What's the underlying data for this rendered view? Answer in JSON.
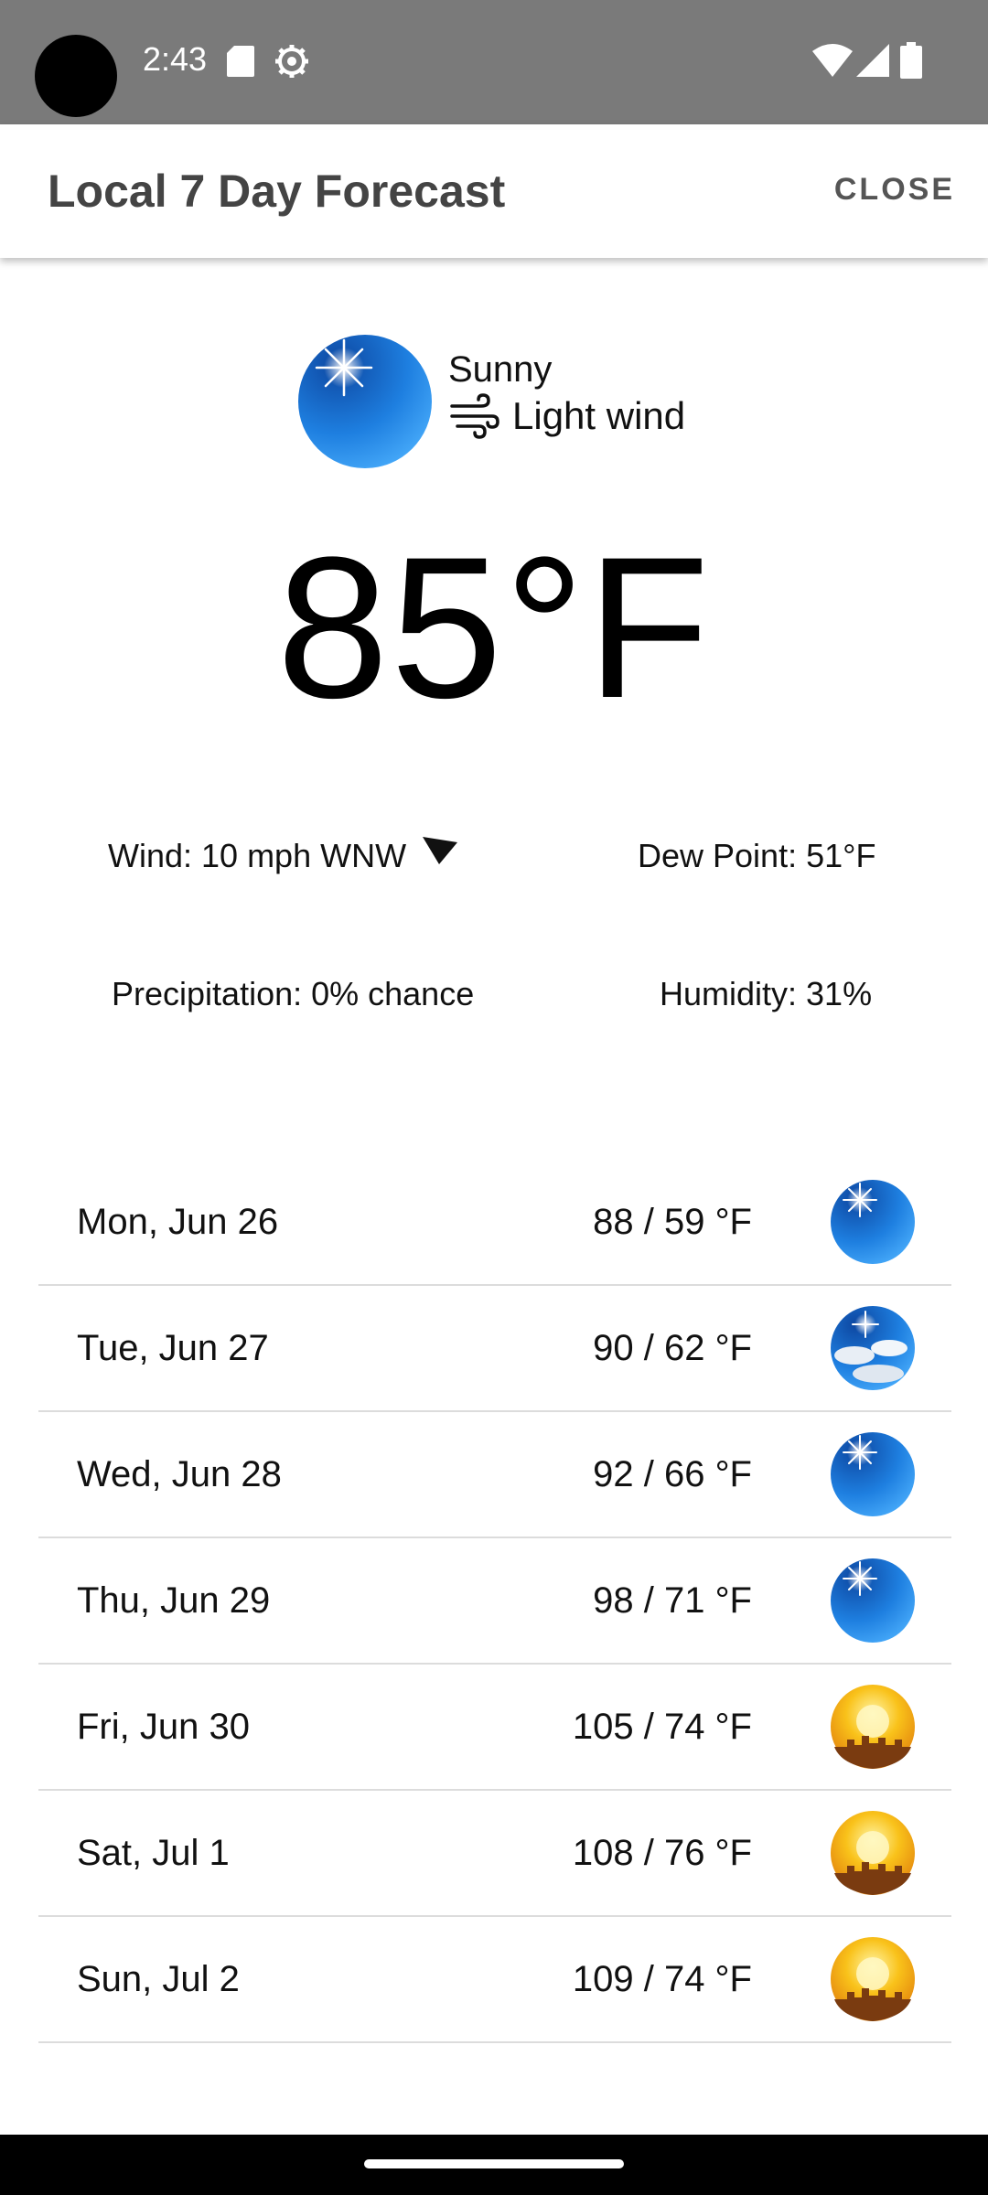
{
  "status_bar": {
    "time": "2:43",
    "icons": [
      "sd-card-icon",
      "gear-icon",
      "wifi-icon",
      "signal-icon",
      "battery-icon"
    ]
  },
  "app_bar": {
    "title": "Local 7 Day Forecast",
    "close_label": "CLOSE"
  },
  "current": {
    "condition": "Sunny",
    "wind_description": "Light wind",
    "temperature": "85°F",
    "icon": "sunny-icon"
  },
  "details": {
    "wind": "Wind: 10 mph WNW",
    "dew_point": "Dew Point: 51°F",
    "precipitation": "Precipitation: 0% chance",
    "humidity": "Humidity: 31%"
  },
  "forecast": [
    {
      "day": "Mon, Jun 26",
      "temps": "88 / 59 °F",
      "icon": "sunny-icon"
    },
    {
      "day": "Tue, Jun 27",
      "temps": "90 / 62 °F",
      "icon": "partly-cloudy-icon"
    },
    {
      "day": "Wed, Jun 28",
      "temps": "92 / 66 °F",
      "icon": "sunny-icon"
    },
    {
      "day": "Thu, Jun 29",
      "temps": "98 / 71 °F",
      "icon": "sunny-icon"
    },
    {
      "day": "Fri, Jun 30",
      "temps": "105 / 74 °F",
      "icon": "hot-icon"
    },
    {
      "day": "Sat, Jul 1",
      "temps": "108 / 76 °F",
      "icon": "hot-icon"
    },
    {
      "day": "Sun, Jul 2",
      "temps": "109 / 74 °F",
      "icon": "hot-icon"
    }
  ],
  "colors": {
    "status_bar": "#7a7a7a",
    "sky_blue_top": "#1565c0",
    "sky_blue_bottom": "#42a5f5",
    "hot_sun": "#f5b316",
    "divider": "#dcdcdc"
  }
}
